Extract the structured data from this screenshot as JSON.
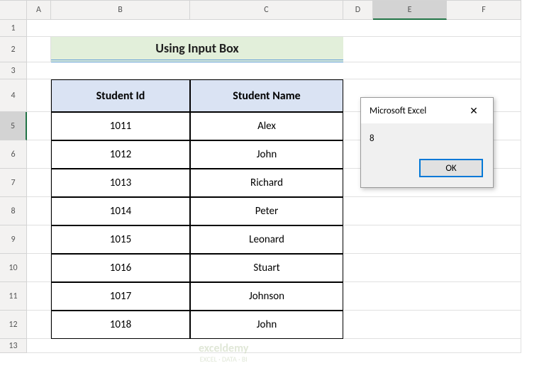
{
  "columns": [
    "A",
    "B",
    "C",
    "D",
    "E",
    "F"
  ],
  "rows": [
    "1",
    "2",
    "3",
    "4",
    "5",
    "6",
    "7",
    "8",
    "9",
    "10",
    "11",
    "12",
    "13"
  ],
  "selected_column": "E",
  "selected_row": "5",
  "title": "Using Input Box",
  "table": {
    "headers": [
      "Student Id",
      "Student Name"
    ],
    "data": [
      [
        "1011",
        "Alex"
      ],
      [
        "1012",
        "John"
      ],
      [
        "1013",
        "Richard"
      ],
      [
        "1014",
        "Peter"
      ],
      [
        "1015",
        "Leonard"
      ],
      [
        "1016",
        "Stuart"
      ],
      [
        "1017",
        "Johnson"
      ],
      [
        "1018",
        "John"
      ]
    ]
  },
  "dialog": {
    "title": "Microsoft Excel",
    "message": "8",
    "ok_label": "OK"
  },
  "watermark": {
    "brand": "exceldemy",
    "tagline": "EXCEL · DATA · BI"
  }
}
